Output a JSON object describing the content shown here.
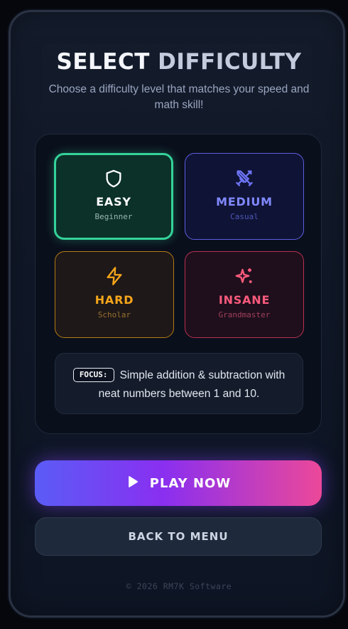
{
  "header": {
    "title_part1": "SELECT",
    "title_part2": "DIFFICULTY",
    "subtitle": "Choose a difficulty level that matches your speed and math skill!"
  },
  "difficulties": [
    {
      "id": "easy",
      "label": "EASY",
      "sublabel": "Beginner",
      "icon": "shield-icon",
      "accent": "#34d399",
      "selected": true
    },
    {
      "id": "medium",
      "label": "MEDIUM",
      "sublabel": "Casual",
      "icon": "crossed-swords-icon",
      "accent": "#6366f1",
      "selected": false
    },
    {
      "id": "hard",
      "label": "HARD",
      "sublabel": "Scholar",
      "icon": "lightning-icon",
      "accent": "#f59e0b",
      "selected": false
    },
    {
      "id": "insane",
      "label": "INSANE",
      "sublabel": "Grandmaster",
      "icon": "sparkles-icon",
      "accent": "#f43f5e",
      "selected": false
    }
  ],
  "focus": {
    "tag": "FOCUS:",
    "description": "Simple addition & subtraction with neat numbers between 1 and 10."
  },
  "actions": {
    "play_label": "PLAY NOW",
    "back_label": "BACK TO MENU"
  },
  "footer": {
    "copyright": "© 2026 RM7K Software"
  }
}
